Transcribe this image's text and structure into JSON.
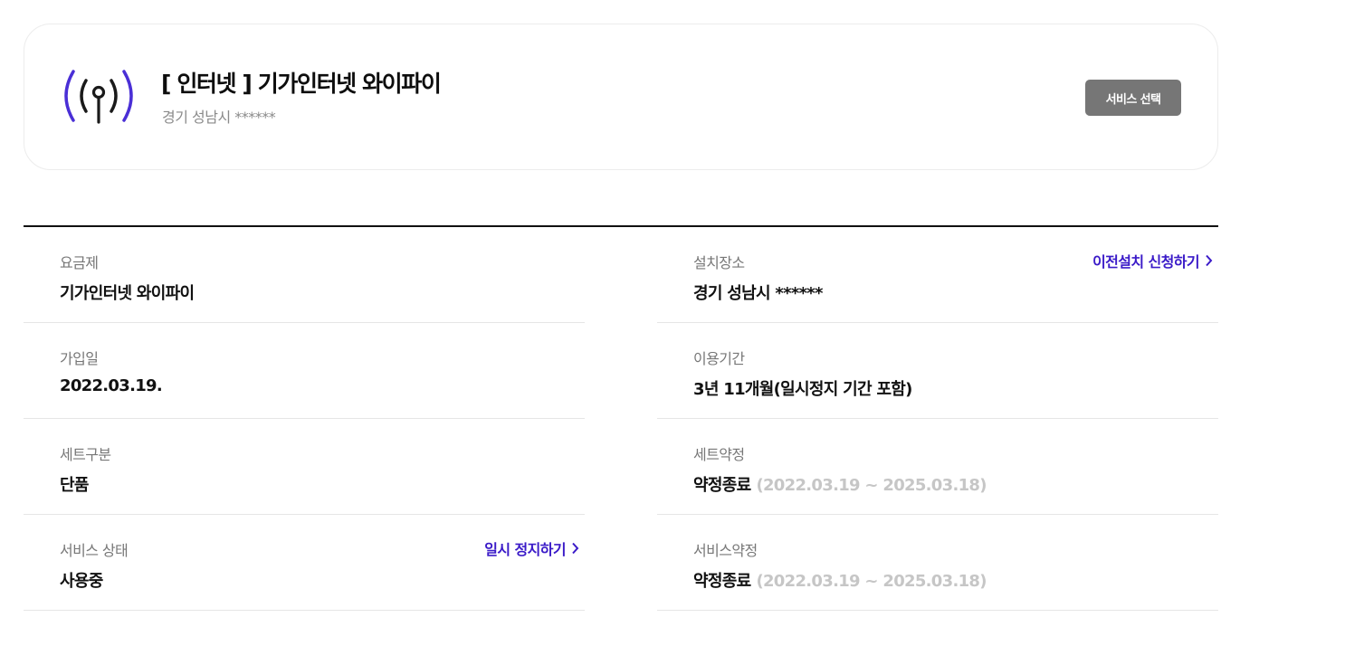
{
  "service": {
    "title": "[ 인터넷 ] 기가인터넷 와이파이",
    "address": "경기 성남시 ******",
    "select_label": "서비스 선택",
    "icon": "antenna-broadcast-icon",
    "icon_color": "#4a2fd6"
  },
  "details": {
    "plan": {
      "label": "요금제",
      "value": "기가인터넷 와이파이"
    },
    "location": {
      "label": "설치장소",
      "value": "경기 성남시 ******",
      "link": "이전설치 신청하기"
    },
    "join_date": {
      "label": "가입일",
      "value": "2022.03.19."
    },
    "usage_period": {
      "label": "이용기간",
      "value": "3년 11개월(일시정지 기간 포함)"
    },
    "set_type": {
      "label": "세트구분",
      "value": "단품"
    },
    "set_contract": {
      "label": "세트약정",
      "value": "약정종료",
      "period": "(2022.03.19 ~ 2025.03.18)"
    },
    "service_status": {
      "label": "서비스 상태",
      "value": "사용중",
      "link": "일시 정지하기"
    },
    "service_contract": {
      "label": "서비스약정",
      "value": "약정종료",
      "period": "(2022.03.19 ~ 2025.03.18)"
    }
  },
  "colors": {
    "accent": "#3a1ac8",
    "button": "#767676",
    "muted_text": "#c6c6c6"
  }
}
